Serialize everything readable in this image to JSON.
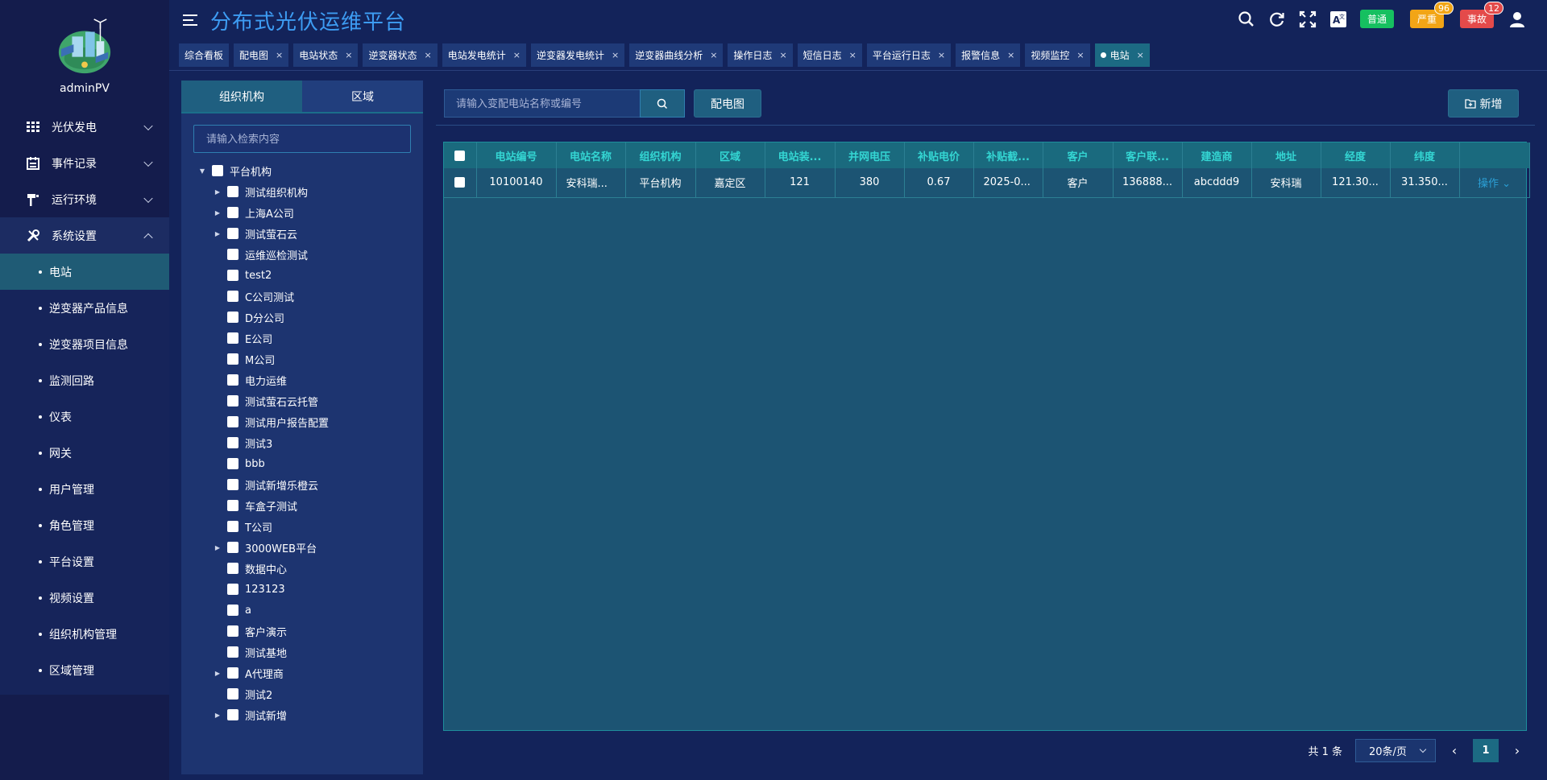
{
  "sidebar": {
    "username": "adminPV",
    "groups": [
      {
        "label": "光伏发电",
        "icon": "grid-icon"
      },
      {
        "label": "事件记录",
        "icon": "calendar-icon"
      },
      {
        "label": "运行环境",
        "icon": "pole-icon"
      },
      {
        "label": "系统设置",
        "icon": "tools-icon"
      }
    ],
    "sub_items": [
      "电站",
      "逆变器产品信息",
      "逆变器项目信息",
      "监测回路",
      "仪表",
      "网关",
      "用户管理",
      "角色管理",
      "平台设置",
      "视频设置",
      "组织机构管理",
      "区域管理"
    ]
  },
  "header": {
    "title": "分布式光伏运维平台",
    "alarm_normal": "普通",
    "alarm_serious": "严重",
    "alarm_serious_count": "96",
    "alarm_accident": "事故",
    "alarm_accident_count": "12",
    "colors": {
      "normal": "#16c060",
      "serious": "#f2a516",
      "accident": "#e44a4a"
    }
  },
  "tabs": [
    "综合看板",
    "配电图",
    "电站状态",
    "逆变器状态",
    "电站发电统计",
    "逆变器发电统计",
    "逆变器曲线分析",
    "操作日志",
    "短信日志",
    "平台运行日志",
    "报警信息",
    "视频监控",
    "电站"
  ],
  "tree_panel": {
    "tab_org": "组织机构",
    "tab_region": "区域",
    "search_placeholder": "请输入检索内容",
    "root": "平台机构",
    "nodes": [
      {
        "label": "测试组织机构",
        "expandable": true
      },
      {
        "label": "上海A公司",
        "expandable": true
      },
      {
        "label": "测试萤石云",
        "expandable": true
      },
      {
        "label": "运维巡检测试",
        "expandable": false
      },
      {
        "label": "test2",
        "expandable": false
      },
      {
        "label": "C公司测试",
        "expandable": false
      },
      {
        "label": "D分公司",
        "expandable": false
      },
      {
        "label": "E公司",
        "expandable": false
      },
      {
        "label": "M公司",
        "expandable": false
      },
      {
        "label": "电力运维",
        "expandable": false
      },
      {
        "label": "测试萤石云托管",
        "expandable": false
      },
      {
        "label": "测试用户报告配置",
        "expandable": false
      },
      {
        "label": "测试3",
        "expandable": false
      },
      {
        "label": "bbb",
        "expandable": false
      },
      {
        "label": "测试新增乐橙云",
        "expandable": false
      },
      {
        "label": "车盒子测试",
        "expandable": false
      },
      {
        "label": "T公司",
        "expandable": false
      },
      {
        "label": "3000WEB平台",
        "expandable": true
      },
      {
        "label": "数据中心",
        "expandable": false
      },
      {
        "label": "123123",
        "expandable": false
      },
      {
        "label": "a",
        "expandable": false
      },
      {
        "label": "客户演示",
        "expandable": false
      },
      {
        "label": "测试基地",
        "expandable": false
      },
      {
        "label": "A代理商",
        "expandable": true
      },
      {
        "label": "测试2",
        "expandable": false
      },
      {
        "label": "测试新增",
        "expandable": true
      }
    ]
  },
  "main": {
    "search_placeholder": "请输入变配电站名称或编号",
    "diagram_button": "配电图",
    "add_button": "新增",
    "columns": [
      "电站编号",
      "电站名称",
      "组织机构",
      "区域",
      "电站装...",
      "并网电压",
      "补贴电价",
      "补贴截...",
      "客户",
      "客户联...",
      "建造商",
      "地址",
      "经度",
      "纬度"
    ],
    "rows": [
      [
        "10100140",
        "安科瑞...",
        "平台机构",
        "嘉定区",
        "121",
        "380",
        "0.67",
        "2025-0...",
        "客户",
        "136888...",
        "abcddd9",
        "安科瑞",
        "121.30...",
        "31.350..."
      ]
    ],
    "row_action": "操作",
    "pagination": {
      "total": "共 1 条",
      "page_size": "20条/页",
      "current_page": "1"
    }
  }
}
